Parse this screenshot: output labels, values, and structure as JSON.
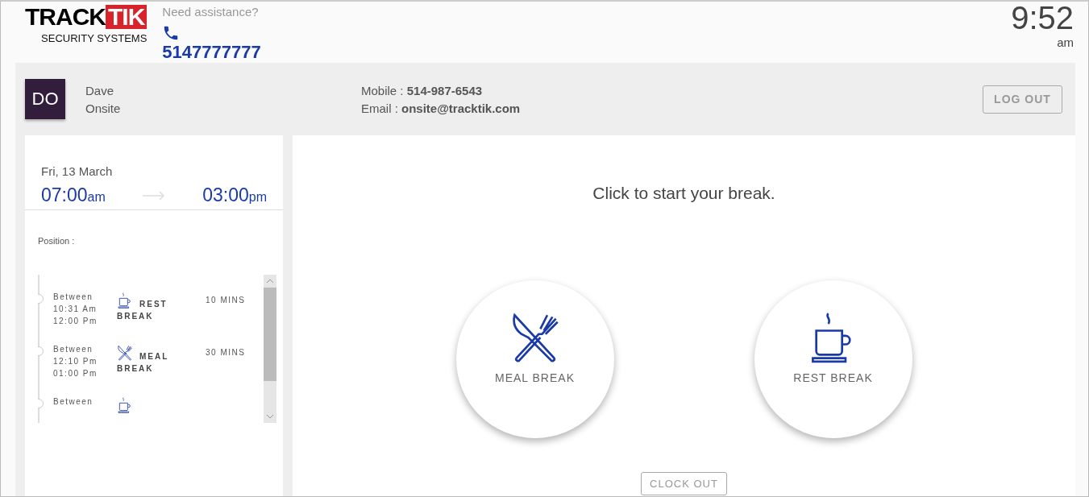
{
  "header": {
    "logo": {
      "word_1": "TRACK",
      "word_2": "TIK",
      "tagline": "SECURITY SYSTEMS"
    },
    "assistance": {
      "label": "Need assistance?",
      "phone": "5147777777"
    },
    "clock": {
      "time": "9:52",
      "period": "am"
    }
  },
  "user": {
    "initials": "DO",
    "first_name": "Dave",
    "last_name": "Onsite",
    "mobile_label": "Mobile : ",
    "mobile": "514-987-6543",
    "email_label": "Email : ",
    "email": "onsite@tracktik.com",
    "logout": "LOG OUT"
  },
  "shift": {
    "date": "Fri, 13 March",
    "start": "07:00",
    "start_period": "am",
    "end": "03:00",
    "end_period": "pm",
    "position_label": "Position :"
  },
  "breaks": [
    {
      "kind": "rest",
      "between": "Between",
      "from": "10:31 Am",
      "to": "12:00 Pm",
      "label_1": "REST",
      "label_2": "BREAK",
      "duration": "10 MINS"
    },
    {
      "kind": "meal",
      "between": "Between",
      "from": "12:10 Pm",
      "to": "01:00 Pm",
      "label_1": "MEAL",
      "label_2": "BREAK",
      "duration": "30 MINS"
    },
    {
      "kind": "rest",
      "between": "Between"
    }
  ],
  "main": {
    "prompt": "Click to start your break.",
    "options": [
      {
        "kind": "meal",
        "label": "MEAL BREAK"
      },
      {
        "kind": "rest",
        "label": "REST BREAK"
      }
    ],
    "clock_out": "CLOCK OUT"
  }
}
